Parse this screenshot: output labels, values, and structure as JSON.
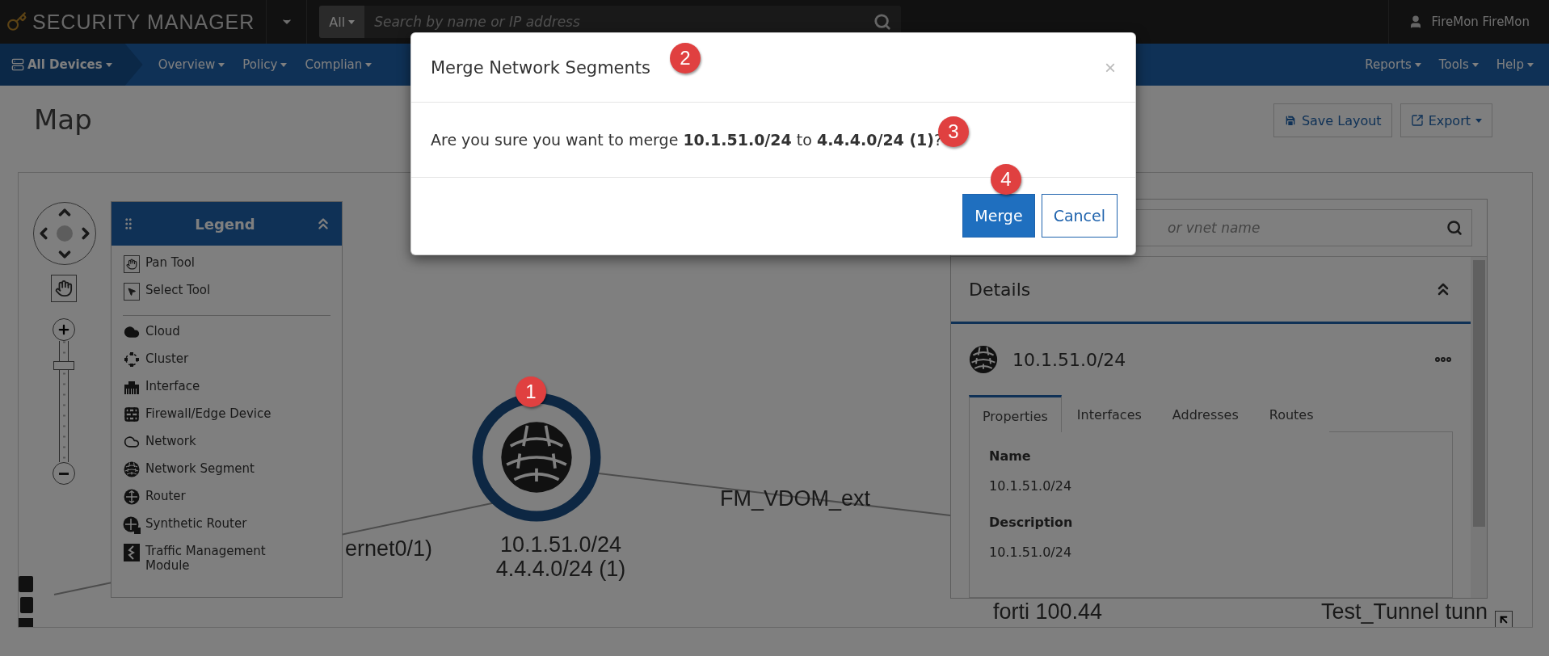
{
  "top_bar": {
    "brand": "SECURITY MANAGER",
    "search_scope": "All",
    "search_placeholder": "Search by name or IP address",
    "user": "FireMon FireMon"
  },
  "nav": {
    "left": [
      {
        "label": "All Devices",
        "selected": true
      },
      {
        "label": "Overview",
        "selected": false
      },
      {
        "label": "Policy",
        "selected": false
      },
      {
        "label": "Complian",
        "selected": false
      }
    ],
    "right": [
      {
        "label": "Reports"
      },
      {
        "label": "Tools"
      },
      {
        "label": "Help"
      }
    ]
  },
  "page": {
    "title": "Map",
    "buttons": [
      {
        "label": "Save Layout",
        "kind": "save"
      },
      {
        "label": "Export",
        "kind": "export"
      }
    ]
  },
  "zoom": {
    "level": 0.82
  },
  "legend": {
    "title": "Legend",
    "tools": [
      {
        "label": "Pan Tool",
        "kind": "pan"
      },
      {
        "label": "Select Tool",
        "kind": "select"
      }
    ],
    "types": [
      {
        "label": "Cloud",
        "kind": "cloud"
      },
      {
        "label": "Cluster",
        "kind": "cluster"
      },
      {
        "label": "Interface",
        "kind": "interface"
      },
      {
        "label": "Firewall/Edge Device",
        "kind": "firewall"
      },
      {
        "label": "Network",
        "kind": "network"
      },
      {
        "label": "Network Segment",
        "kind": "segment"
      },
      {
        "label": "Router",
        "kind": "router"
      },
      {
        "label": "Synthetic Router",
        "kind": "synthetic"
      },
      {
        "label": "Traffic Management Module",
        "kind": "traffic"
      }
    ]
  },
  "map": {
    "node": {
      "labels": [
        "10.1.51.0/24",
        "4.4.4.0/24 (1)"
      ],
      "selected": true
    },
    "edge_labels": [
      "ernet0/1)",
      "FM_VDOM_ext",
      "forti 100.44",
      "Test_Tunnel tunn"
    ]
  },
  "details": {
    "search_placeholder": "or vnet name",
    "title": "Details",
    "item": "10.1.51.0/24",
    "tabs": [
      {
        "label": "Properties",
        "selected": true
      },
      {
        "label": "Interfaces",
        "selected": false
      },
      {
        "label": "Addresses",
        "selected": false
      },
      {
        "label": "Routes",
        "selected": false
      }
    ],
    "fields": [
      {
        "label": "Name",
        "value": "10.1.51.0/24"
      },
      {
        "label": "Description",
        "value": "10.1.51.0/24"
      }
    ]
  },
  "dialog": {
    "title": "Merge Network Segments",
    "close": "×",
    "message": "Are you sure you want to merge **10.1.51.0/24** to **4.4.4.0/24 (1)**?",
    "buttons": [
      {
        "label": "Merge",
        "kind": "primary"
      },
      {
        "label": "Cancel",
        "kind": "secondary"
      }
    ]
  },
  "callouts": [
    "1",
    "2",
    "3",
    "4"
  ]
}
